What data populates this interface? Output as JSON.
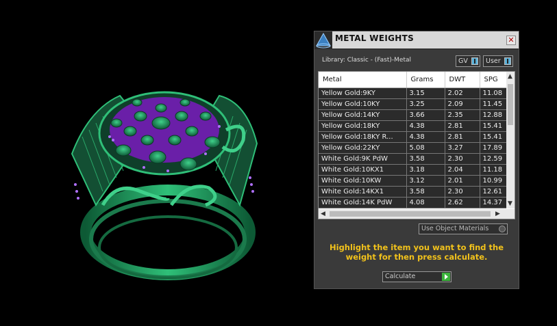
{
  "panel": {
    "title": "METAL WEIGHTS",
    "close_glyph": "✕",
    "library_label": "Library: Classic - (Fast)-Metal",
    "toggle_gv": "GV",
    "toggle_user": "User",
    "columns": [
      "Metal",
      "Grams",
      "DWT",
      "SPG"
    ],
    "rows": [
      [
        "Yellow Gold:9KY",
        "3.15",
        "2.02",
        "11.08"
      ],
      [
        "Yellow Gold:10KY",
        "3.25",
        "2.09",
        "11.45"
      ],
      [
        "Yellow Gold:14KY",
        "3.66",
        "2.35",
        "12.88"
      ],
      [
        "Yellow Gold:18KY",
        "4.38",
        "2.81",
        "15.41"
      ],
      [
        "Yellow Gold:18KY R...",
        "4.38",
        "2.81",
        "15.41"
      ],
      [
        "Yellow Gold:22KY",
        "5.08",
        "3.27",
        "17.89"
      ],
      [
        "White Gold:9K PdW",
        "3.58",
        "2.30",
        "12.59"
      ],
      [
        "White Gold:10KX1",
        "3.18",
        "2.04",
        "11.18"
      ],
      [
        "White Gold:10KW",
        "3.12",
        "2.01",
        "10.99"
      ],
      [
        "White Gold:14KX1",
        "3.58",
        "2.30",
        "12.61"
      ],
      [
        "White Gold:14K PdW",
        "4.08",
        "2.62",
        "14.37"
      ]
    ],
    "use_object_materials": "Use Object Materials",
    "hint": "Highlight the item you want to find the weight for then press calculate.",
    "calculate_label": "Calculate"
  },
  "icons": {
    "logo": "triangle-logo-icon",
    "close": "close-icon",
    "scroll_up": "chevron-up-icon",
    "scroll_down": "chevron-down-icon",
    "scroll_left": "chevron-left-icon",
    "scroll_right": "chevron-right-icon",
    "go": "play-icon"
  },
  "colors": {
    "ring_metal": "#1d8a5a",
    "gem_purple": "#8a2be2",
    "hint": "#f2c21b",
    "calc_go": "#3bb33b"
  }
}
